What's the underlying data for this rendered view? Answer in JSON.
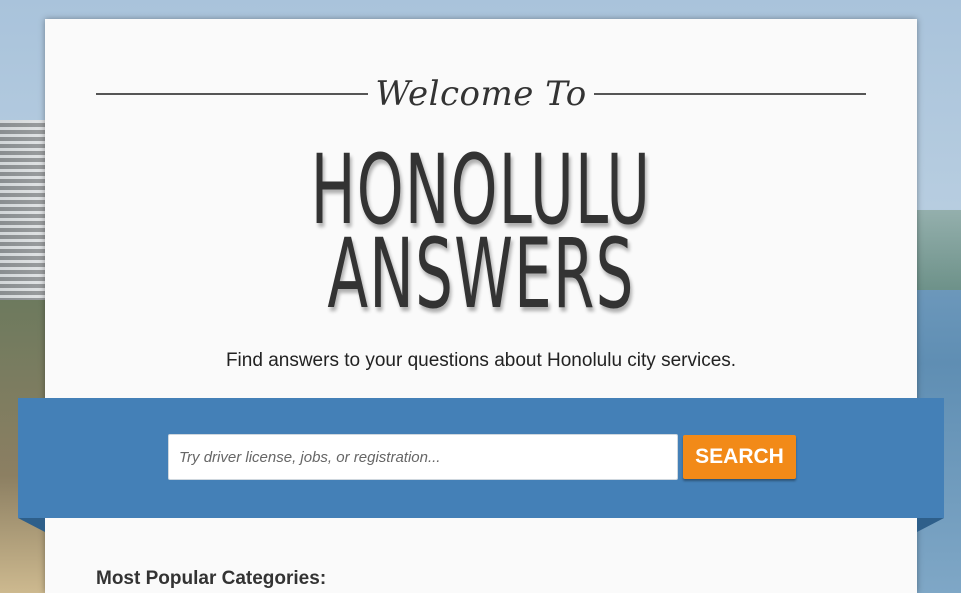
{
  "header": {
    "welcome": "Welcome To",
    "title_line1": "HONOLULU",
    "title_line2": "ANSWERS",
    "tagline": "Find answers to your questions about Honolulu city services."
  },
  "search": {
    "placeholder": "Try driver license, jobs, or registration...",
    "button_label": "SEARCH"
  },
  "categories": {
    "heading": "Most Popular Categories:"
  },
  "colors": {
    "band": "#4480b7",
    "button": "#f28a18",
    "card": "#fafafa",
    "text": "#333333"
  }
}
